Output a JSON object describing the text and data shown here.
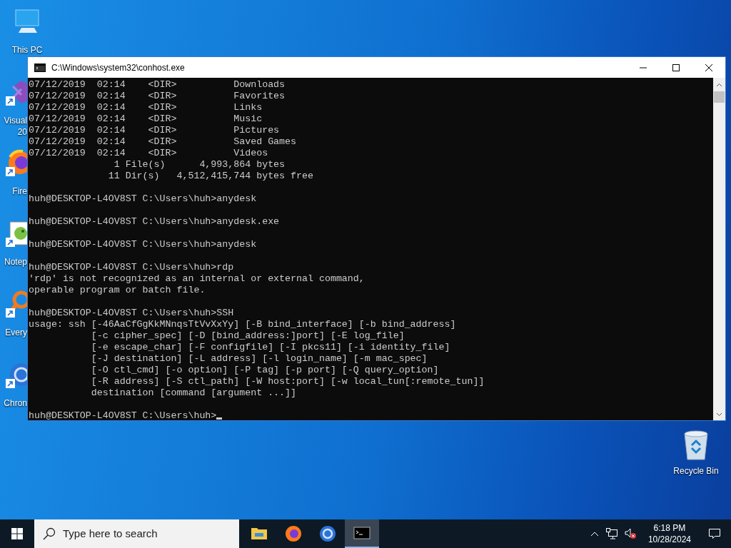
{
  "desktop_icons": [
    {
      "kind": "computer",
      "label_lines": [
        "This PC"
      ],
      "clipped": false,
      "shortcut": false
    },
    {
      "kind": "studio",
      "label_lines": [
        "Visual",
        "20"
      ],
      "clipped": true,
      "shortcut": true
    },
    {
      "kind": "firefox",
      "label_lines": [
        "Fire"
      ],
      "clipped": true,
      "shortcut": true
    },
    {
      "kind": "notepad",
      "label_lines": [
        "Notep"
      ],
      "clipped": true,
      "shortcut": true
    },
    {
      "kind": "everything",
      "label_lines": [
        "Every"
      ],
      "clipped": true,
      "shortcut": true
    },
    {
      "kind": "chrome",
      "label_lines": [
        "Chron"
      ],
      "clipped": true,
      "shortcut": true
    }
  ],
  "recycle_bin": {
    "label": "Recycle Bin"
  },
  "window": {
    "title": "C:\\Windows\\system32\\conhost.exe",
    "blocks": [
      [
        "07/12/2019  02:14    <DIR>          Downloads",
        "07/12/2019  02:14    <DIR>          Favorites",
        "07/12/2019  02:14    <DIR>          Links",
        "07/12/2019  02:14    <DIR>          Music",
        "07/12/2019  02:14    <DIR>          Pictures",
        "07/12/2019  02:14    <DIR>          Saved Games",
        "07/12/2019  02:14    <DIR>          Videos",
        "               1 File(s)      4,993,864 bytes",
        "              11 Dir(s)   4,512,415,744 bytes free"
      ],
      [
        "huh@DESKTOP-L4OV8ST C:\\Users\\huh>anydesk"
      ],
      [
        "huh@DESKTOP-L4OV8ST C:\\Users\\huh>anydesk.exe"
      ],
      [
        "huh@DESKTOP-L4OV8ST C:\\Users\\huh>anydesk"
      ],
      [
        "huh@DESKTOP-L4OV8ST C:\\Users\\huh>rdp",
        "'rdp' is not recognized as an internal or external command,",
        "operable program or batch file."
      ],
      [
        "huh@DESKTOP-L4OV8ST C:\\Users\\huh>SSH",
        "usage: ssh [-46AaCfGgKkMNnqsTtVvXxYy] [-B bind_interface] [-b bind_address]",
        "           [-c cipher_spec] [-D [bind_address:]port] [-E log_file]",
        "           [-e escape_char] [-F configfile] [-I pkcs11] [-i identity_file]",
        "           [-J destination] [-L address] [-l login_name] [-m mac_spec]",
        "           [-O ctl_cmd] [-o option] [-P tag] [-p port] [-Q query_option]",
        "           [-R address] [-S ctl_path] [-W host:port] [-w local_tun[:remote_tun]]",
        "           destination [command [argument ...]]"
      ],
      [
        "huh@DESKTOP-L4OV8ST C:\\Users\\huh>"
      ]
    ]
  },
  "taskbar": {
    "search": {
      "placeholder": "Type here to search"
    },
    "apps": [
      {
        "kind": "folder",
        "selected": false
      },
      {
        "kind": "firefox",
        "selected": false
      },
      {
        "kind": "chrome",
        "selected": false
      },
      {
        "kind": "console",
        "selected": true
      }
    ],
    "time": "6:18 PM",
    "date": "10/28/2024"
  }
}
